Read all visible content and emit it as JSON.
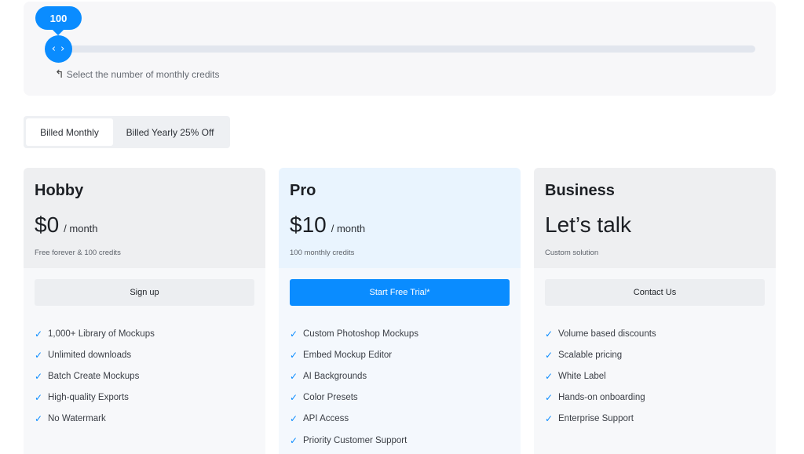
{
  "slider": {
    "value_label": "100",
    "handle_glyph": "‹ ›",
    "hint_arrow": "↰",
    "hint": "Select the number of monthly credits"
  },
  "billing": {
    "options": [
      "Billed Monthly",
      "Billed Yearly 25% Off"
    ],
    "selected": "Billed Monthly"
  },
  "plans": [
    {
      "name": "Hobby",
      "price": "$0",
      "period": "/ month",
      "subtitle": "Free forever & 100 credits",
      "cta": "Sign up",
      "features": [
        "1,000+ Library of Mockups",
        "Unlimited downloads",
        "Batch Create Mockups",
        "High-quality Exports",
        "No Watermark"
      ]
    },
    {
      "name": "Pro",
      "price": "$10",
      "period": "/ month",
      "subtitle": "100 monthly credits",
      "cta": "Start Free Trial*",
      "features": [
        "Custom Photoshop Mockups",
        "Embed Mockup Editor",
        "AI Backgrounds",
        "Color Presets",
        "API Access",
        "Priority Customer Support"
      ]
    },
    {
      "name": "Business",
      "price": "Let’s talk",
      "period": "",
      "subtitle": "Custom solution",
      "cta": "Contact Us",
      "features": [
        "Volume based discounts",
        "Scalable pricing",
        "White Label",
        "Hands-on onboarding",
        "Enterprise Support"
      ]
    }
  ],
  "check_glyph": "✓",
  "colors": {
    "accent": "#0a8cff",
    "pro_bg": "#e9f4fe"
  }
}
